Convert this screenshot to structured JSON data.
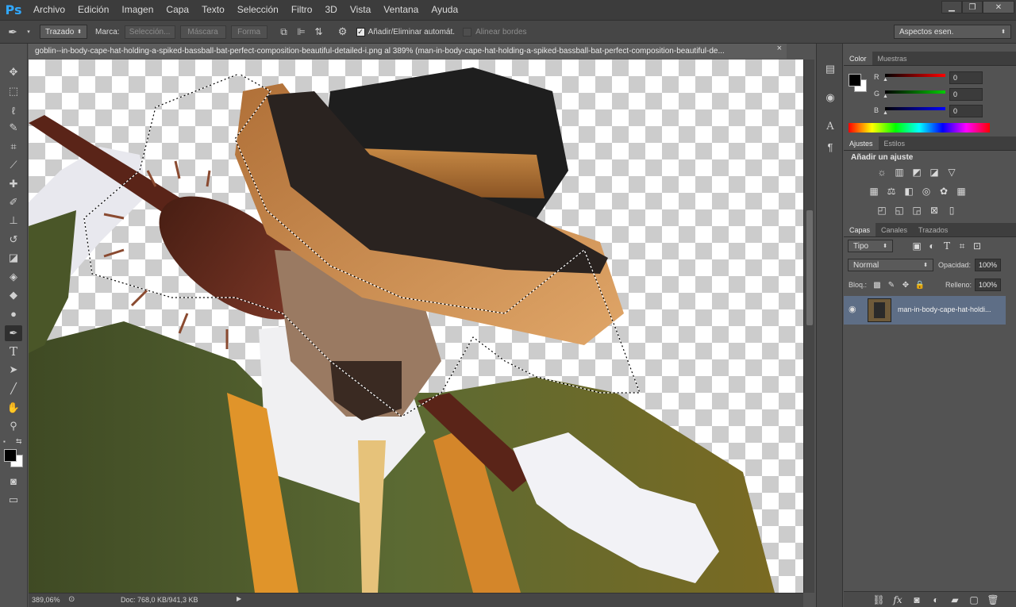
{
  "menubar": {
    "logo": "Ps",
    "items": [
      "Archivo",
      "Edición",
      "Imagen",
      "Capa",
      "Texto",
      "Selección",
      "Filtro",
      "3D",
      "Vista",
      "Ventana",
      "Ayuda"
    ],
    "window_controls": [
      "minimize",
      "restore",
      "close"
    ]
  },
  "options": {
    "mode": "Trazado",
    "marca_label": "Marca:",
    "seleccion": "Selección...",
    "mascara": "Máscara",
    "forma": "Forma",
    "auto_add_delete": "Añadir/Eliminar automát.",
    "auto_add_delete_checked": true,
    "align_edges": "Alinear bordes",
    "align_edges_checked": false,
    "workspace": "Aspectos esen."
  },
  "document": {
    "tab_title": "goblin--in-body-cape-hat-holding-a-spiked-bassball-bat-perfect-composition-beautiful-detailed-i.png al 389% (man-in-body-cape-hat-holding-a-spiked-bassball-bat-perfect-composition-beautiful-de...",
    "close": "×"
  },
  "status": {
    "zoom": "389,06%",
    "doc": "Doc: 768,0 KB/941,3 KB"
  },
  "color_panel": {
    "tabs": [
      "Color",
      "Muestras"
    ],
    "active_tab": "Color",
    "channels": [
      {
        "label": "R",
        "value": "0",
        "color": "#ff0000"
      },
      {
        "label": "G",
        "value": "0",
        "color": "#00cc00"
      },
      {
        "label": "B",
        "value": "0",
        "color": "#0000ff"
      }
    ],
    "foreground": "#000000",
    "background": "#ffffff"
  },
  "adjust_panel": {
    "tabs": [
      "Ajustes",
      "Estilos"
    ],
    "active_tab": "Ajustes",
    "heading": "Añadir un ajuste"
  },
  "layers_panel": {
    "tabs": [
      "Capas",
      "Canales",
      "Trazados"
    ],
    "active_tab": "Capas",
    "filter": "Tipo",
    "blend_mode": "Normal",
    "opacity_label": "Opacidad:",
    "opacity": "100%",
    "lock_label": "Bloq.:",
    "fill_label": "Relleno:",
    "fill": "100%",
    "layers": [
      {
        "name": "man-in-body-cape-hat-holdi...",
        "visible": true,
        "selected": true
      }
    ]
  },
  "tools": [
    "move",
    "marquee",
    "lasso",
    "quick-select",
    "crop",
    "eyedropper",
    "healing",
    "brush",
    "clone-stamp",
    "history-brush",
    "eraser",
    "paint-bucket",
    "blur",
    "dodge",
    "pen",
    "type",
    "path-select",
    "line",
    "hand",
    "zoom"
  ],
  "active_tool": "pen"
}
